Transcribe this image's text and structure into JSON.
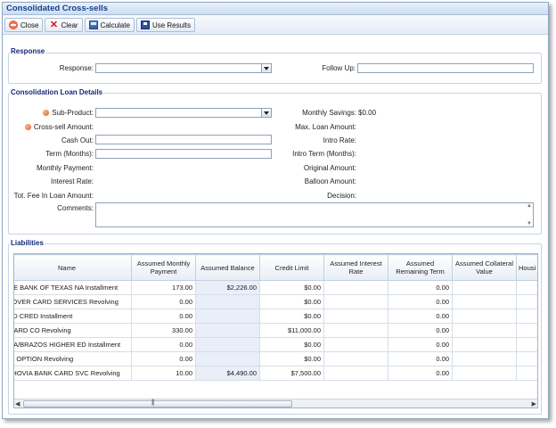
{
  "window": {
    "title": "Consolidated Cross-sells"
  },
  "toolbar": {
    "close": "Close",
    "clear": "Clear",
    "calculate": "Calculate",
    "use_results": "Use Results"
  },
  "response": {
    "legend": "Response",
    "response_label": "Response:",
    "response_value": "",
    "follow_up_label": "Follow Up:",
    "follow_up_value": ""
  },
  "loan": {
    "legend": "Consolidation Loan Details",
    "sub_product_label": "Sub-Product:",
    "cross_sell_label": "Cross-sell Amount:",
    "cash_out_label": "Cash Out:",
    "term_label": "Term (Months):",
    "monthly_payment_label": "Monthly Payment:",
    "interest_rate_label": "Interest Rate:",
    "tot_fee_label": "Tot. Fee In Loan Amount:",
    "comments_label": "Comments:",
    "monthly_savings_label": "Monthly Savings:",
    "monthly_savings_value": "$0.00",
    "max_loan_label": "Max. Loan Amount:",
    "intro_rate_label": "Intro Rate:",
    "intro_term_label": "Intro Term (Months):",
    "original_amount_label": "Original Amount:",
    "balloon_amount_label": "Balloon Amount:",
    "decision_label": "Decision:"
  },
  "liabilities": {
    "legend": "Liabilities",
    "columns": [
      "Name",
      "Assumed Monthly Payment",
      "Assumed Balance",
      "Credit Limit",
      "Assumed Interest Rate",
      "Assumed Remaining Term",
      "Assumed Collateral Value",
      "Housi"
    ],
    "rows": [
      {
        "name": "IASE BANK OF TEXAS NA Installment",
        "payment": "173.00",
        "balance": "$2,226.00",
        "limit": "$0.00",
        "rate": "",
        "term": "0.00",
        "collateral": ""
      },
      {
        "name": "SCOVER CARD SERVICES Revolving",
        "payment": "0.00",
        "balance": "",
        "limit": "$0.00",
        "rate": "",
        "term": "0.00",
        "collateral": ""
      },
      {
        "name": "ORD CRED Installment",
        "payment": "0.00",
        "balance": "",
        "limit": "$0.00",
        "rate": "",
        "term": "0.00",
        "collateral": ""
      },
      {
        "name": "E CARD CO Revolving",
        "payment": "330.00",
        "balance": "",
        "limit": "$11,000.00",
        "rate": "",
        "term": "0.00",
        "collateral": ""
      },
      {
        "name": "IEAA/BRAZOS HIGHER ED Installment",
        "payment": "0.00",
        "balance": "",
        "limit": "$0.00",
        "rate": "",
        "term": "0.00",
        "collateral": ""
      },
      {
        "name": "IME OPTION Revolving",
        "payment": "0.00",
        "balance": "",
        "limit": "$0.00",
        "rate": "",
        "term": "0.00",
        "collateral": ""
      },
      {
        "name": "ACHOVIA BANK CARD SVC Revolving",
        "payment": "10.00",
        "balance": "$4,490.00",
        "limit": "$7,500.00",
        "rate": "",
        "term": "0.00",
        "collateral": ""
      }
    ]
  }
}
